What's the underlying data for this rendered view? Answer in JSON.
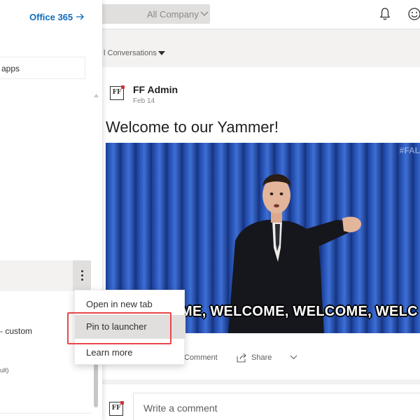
{
  "header": {
    "company_selector": "All Company"
  },
  "feed": {
    "filter_label": "l Conversations"
  },
  "post": {
    "author": "FF Admin",
    "date": "Feb 14",
    "headline": "Welcome to our Yammer!",
    "gif_caption": "ME, WELCOME, WELCOME, WELC",
    "gif_tag": "#FAL",
    "actions": {
      "comment": "Comment",
      "share": "Share"
    },
    "comment_placeholder": "Write a comment"
  },
  "launcher": {
    "office_link": "Office 365",
    "apps_label": "apps",
    "custom_label": "- custom",
    "ult_label": "ult)"
  },
  "context_menu": {
    "items": [
      "Open in new tab",
      "Pin to launcher",
      "Learn more"
    ],
    "highlighted_index": 1
  },
  "colors": {
    "accent": "#0f6cbd",
    "highlight_border": "#e8474b"
  },
  "icons": [
    "bell-icon",
    "smile-icon",
    "comment-icon",
    "share-icon",
    "arrow-right-icon",
    "more-icon"
  ]
}
